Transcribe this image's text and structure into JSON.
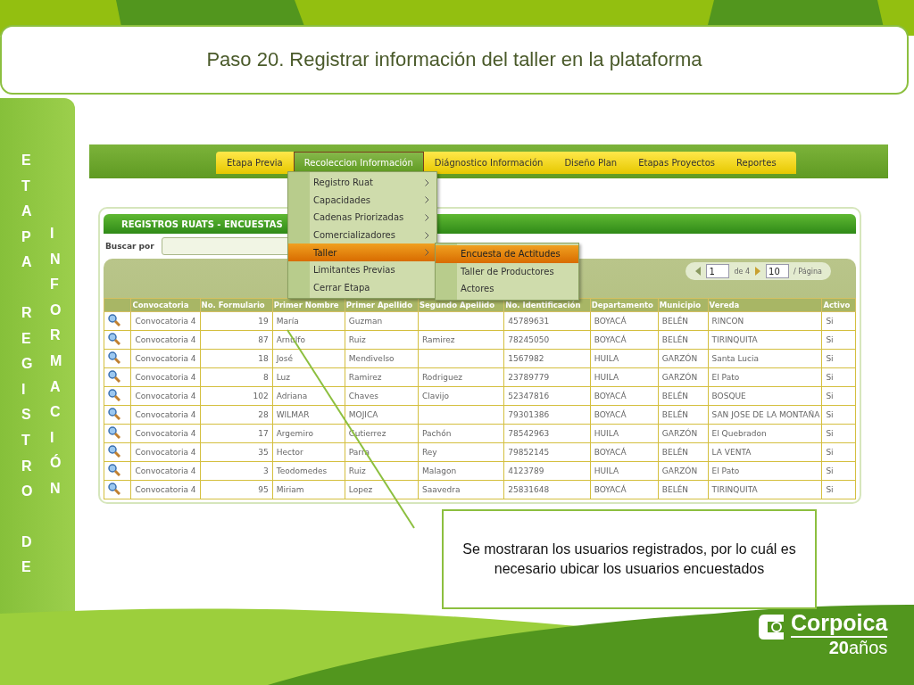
{
  "slide_title": "Paso 20. Registrar información del taller en la plataforma",
  "sidebar": {
    "columns": [
      {
        "words": [
          "ETAPA",
          "REGISTRO",
          "DE"
        ]
      },
      {
        "words": [
          "INFORMACIÓN"
        ]
      }
    ]
  },
  "app": {
    "nav_tabs": [
      {
        "label": "Etapa Previa",
        "selected": false
      },
      {
        "label": "Recoleccion Información",
        "selected": true
      },
      {
        "label": "Diágnostico Información",
        "selected": false
      },
      {
        "label": "Diseño Plan",
        "selected": false
      },
      {
        "label": "Etapas Proyectos",
        "selected": false
      },
      {
        "label": "Reportes",
        "selected": false
      }
    ],
    "menu": [
      {
        "label": "Registro Ruat",
        "submenu": true,
        "selected": false
      },
      {
        "label": "Capacidades",
        "submenu": true,
        "selected": false
      },
      {
        "label": "Cadenas Priorizadas",
        "submenu": true,
        "selected": false
      },
      {
        "label": "Comercializadores",
        "submenu": true,
        "selected": false
      },
      {
        "label": "Taller",
        "submenu": true,
        "selected": true
      },
      {
        "label": "Limitantes Previas",
        "submenu": false,
        "selected": false
      },
      {
        "label": "Cerrar Etapa",
        "submenu": false,
        "selected": false
      }
    ],
    "submenu": [
      {
        "label": "Encuesta de Actitudes",
        "selected": true
      },
      {
        "label": "Taller de Productores",
        "selected": false
      },
      {
        "label": "Actores",
        "selected": false
      }
    ],
    "panel_title": "REGISTROS RUATS - ENCUESTAS",
    "search_label": "Buscar por",
    "pager": {
      "page": "1",
      "of": "de 4",
      "per_page": "10",
      "per_page_label": "/ Página"
    },
    "table": {
      "columns": [
        "Convocatoria",
        "No. Formulario",
        "Primer Nombre",
        "Primer Apellido",
        "Segundo Apellido",
        "No. Identificación",
        "Departamento",
        "Municipio",
        "Vereda",
        "Activo"
      ],
      "rows": [
        [
          "Convocatoria 4",
          "19",
          "María",
          "Guzman",
          "",
          "45789631",
          "BOYACÁ",
          "BELÉN",
          "RINCON",
          "Si"
        ],
        [
          "Convocatoria 4",
          "87",
          "Arnulfo",
          "Ruiz",
          "Ramirez",
          "78245050",
          "BOYACÁ",
          "BELÉN",
          "TIRINQUITA",
          "Si"
        ],
        [
          "Convocatoria 4",
          "18",
          "José",
          "Mendivelso",
          "",
          "1567982",
          "HUILA",
          "GARZÓN",
          "Santa Lucia",
          "Si"
        ],
        [
          "Convocatoria 4",
          "8",
          "Luz",
          "Ramirez",
          "Rodriguez",
          "23789779",
          "HUILA",
          "GARZÓN",
          "El Pato",
          "Si"
        ],
        [
          "Convocatoria 4",
          "102",
          "Adriana",
          "Chaves",
          "Clavijo",
          "52347816",
          "BOYACÁ",
          "BELÉN",
          "BOSQUE",
          "Si"
        ],
        [
          "Convocatoria 4",
          "28",
          "WILMAR",
          "MOJICA",
          "",
          "79301386",
          "BOYACÁ",
          "BELÉN",
          "SAN JOSE DE LA MONTAÑA",
          "Si"
        ],
        [
          "Convocatoria 4",
          "17",
          "Argemiro",
          "Gutierrez",
          "Pachón",
          "78542963",
          "HUILA",
          "GARZÓN",
          "El Quebradon",
          "Si"
        ],
        [
          "Convocatoria 4",
          "35",
          "Hector",
          "Parra",
          "Rey",
          "79852145",
          "BOYACÁ",
          "BELÉN",
          "LA VENTA",
          "Si"
        ],
        [
          "Convocatoria 4",
          "3",
          "Teodomedes",
          "Ruiz",
          "Malagon",
          "4123789",
          "HUILA",
          "GARZÓN",
          "El Pato",
          "Si"
        ],
        [
          "Convocatoria 4",
          "95",
          "Miriam",
          "Lopez",
          "Saavedra",
          "25831648",
          "BOYACÁ",
          "BELÉN",
          "TIRINQUITA",
          "Si"
        ]
      ]
    }
  },
  "callout": "Se mostraran los usuarios registrados, por lo cuál es necesario ubicar los usuarios encuestados",
  "logo": {
    "name": "Corpoica",
    "tagline": "**20**años"
  }
}
